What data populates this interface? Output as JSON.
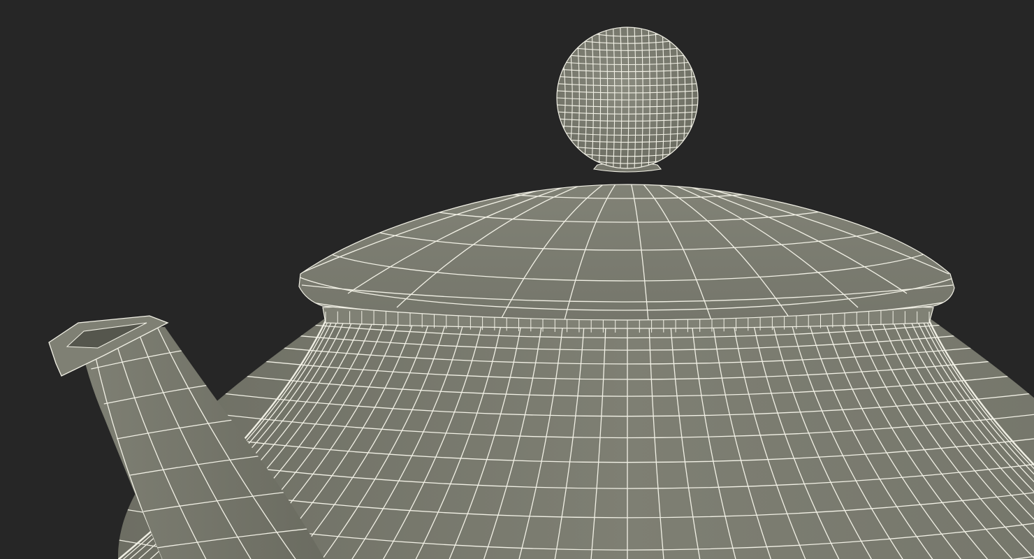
{
  "scene": {
    "subject": "teapot-wireframe-render",
    "colors": {
      "background": "#262626",
      "surface": "#7b7c70",
      "surface_dark": "#6c6d62",
      "surface_light": "#85867a",
      "wire": "#f2f1e6"
    }
  }
}
